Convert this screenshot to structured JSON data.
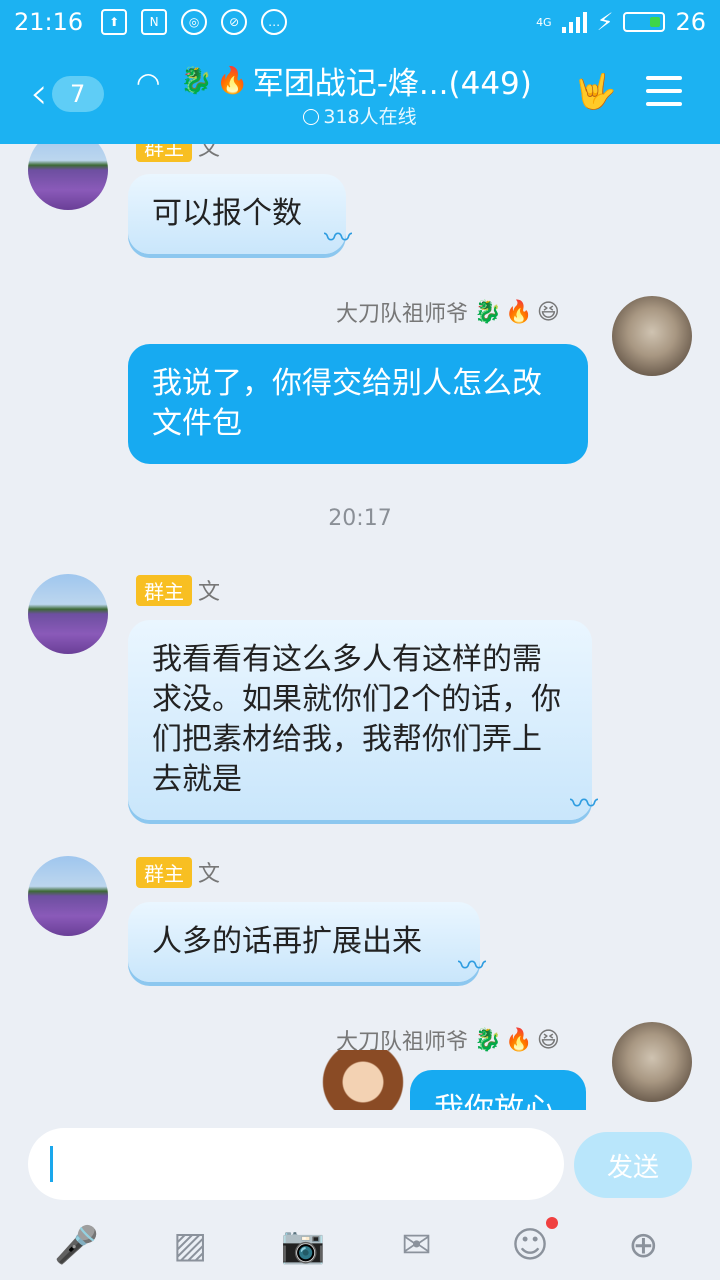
{
  "status": {
    "time": "21:16",
    "network": "4G",
    "battery": "26",
    "icons": [
      "upload-icon",
      "news-icon",
      "sync-icon",
      "blocked-icon",
      "chat-icon"
    ]
  },
  "header": {
    "back_count": "7",
    "title": "军团战记-烽...(449)",
    "title_emojis": [
      "🐉",
      "🔥"
    ],
    "online_text": "318人在线"
  },
  "messages": [
    {
      "side": "left",
      "role": "群主",
      "name": "文",
      "text": "可以报个数"
    },
    {
      "side": "right",
      "name": "大刀队祖师爷",
      "emojis": [
        "🐉",
        "🔥",
        "😆"
      ],
      "text": "我说了，你得交给别人怎么改文件包"
    },
    {
      "timestamp": "20:17"
    },
    {
      "side": "left",
      "role": "群主",
      "name": "文",
      "text": "我看看有这么多人有这样的需求没。如果就你们2个的话，你们把素材给我，我帮你们弄上去就是"
    },
    {
      "side": "left",
      "role": "群主",
      "name": "文",
      "text": "人多的话再扩展出来"
    },
    {
      "side": "right",
      "name": "大刀队祖师爷",
      "emojis": [
        "🐉",
        "🔥",
        "😆"
      ],
      "text": "我你放心"
    }
  ],
  "input": {
    "placeholder": "",
    "send_label": "发送"
  },
  "toolbar": [
    "mic-icon",
    "image-icon",
    "camera-icon",
    "red-packet-icon",
    "emoji-icon",
    "plus-icon"
  ],
  "colors": {
    "accent": "#1cb2f2",
    "bubble_right": "#17aaf1",
    "owner_tag": "#f8bf22"
  }
}
